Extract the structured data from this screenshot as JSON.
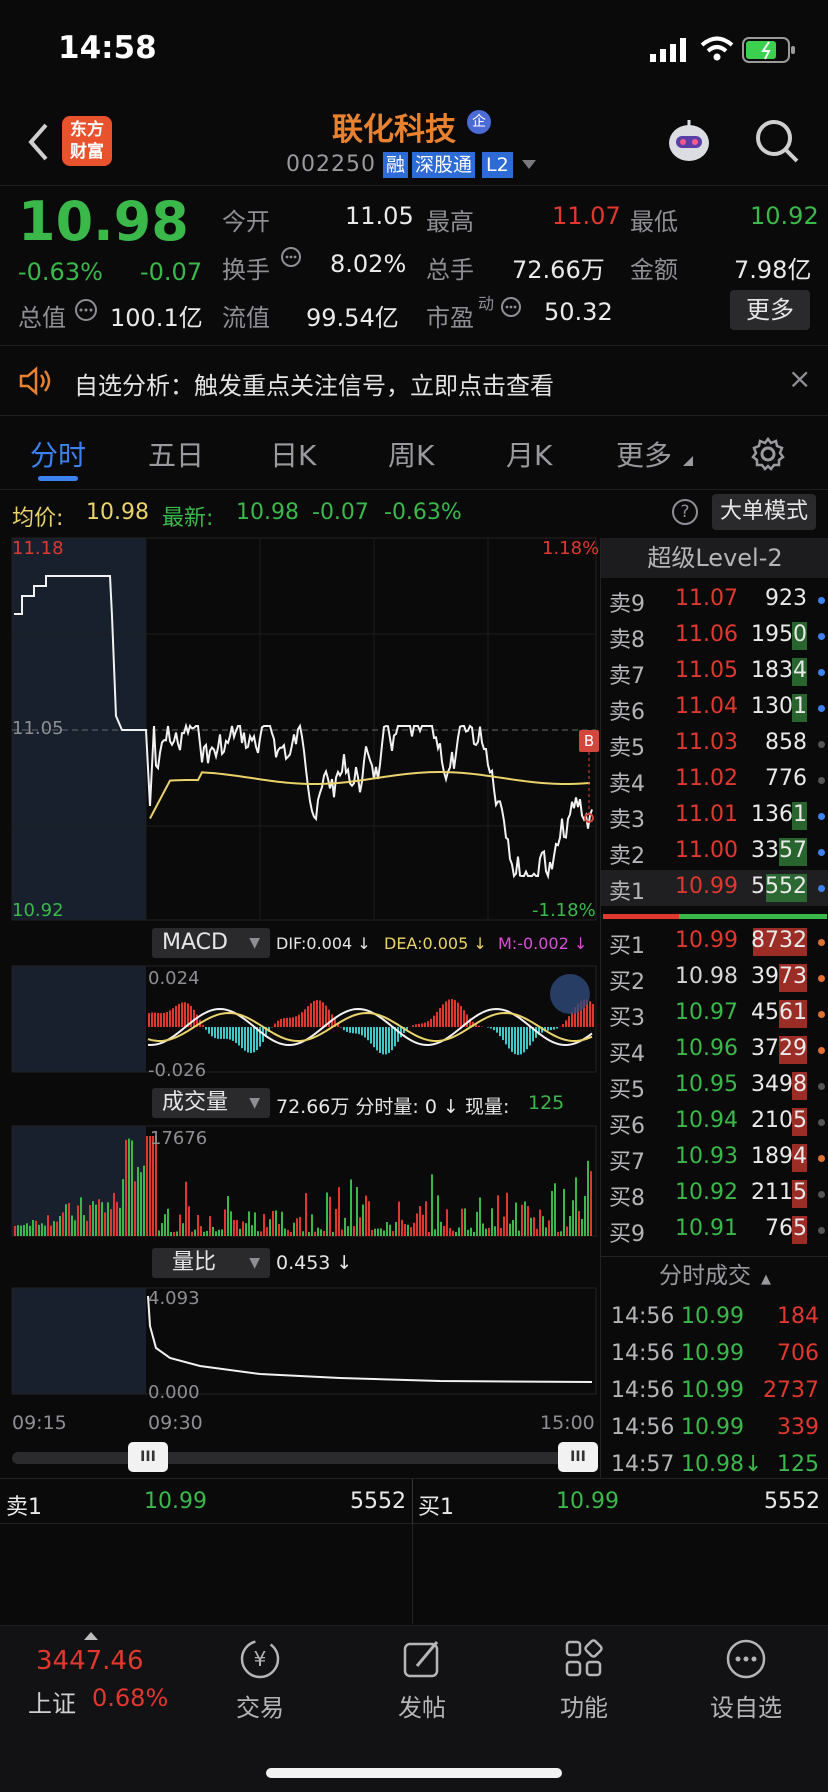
{
  "status": {
    "time": "14:58"
  },
  "header": {
    "logo_line1": "东方",
    "logo_line2": "财富",
    "stock_name": "联化科技",
    "corp_badge": "企",
    "stock_code": "002250",
    "tags": [
      "融",
      "深股通",
      "L2"
    ]
  },
  "quote": {
    "price": "10.98",
    "change_pct": "-0.63%",
    "change": "-0.07",
    "market_value_label": "总值",
    "market_value": "100.1亿",
    "float_value_label": "流值",
    "float_value": "99.54亿",
    "stats": [
      {
        "label": "今开",
        "value": "11.05"
      },
      {
        "label": "最高",
        "value": "11.07"
      },
      {
        "label": "最低",
        "value": "10.92"
      },
      {
        "label": "换手",
        "value": "8.02%"
      },
      {
        "label": "总手",
        "value": "72.66万"
      },
      {
        "label": "金额",
        "value": "7.98亿"
      },
      {
        "label": "市盈",
        "sup": "动",
        "value": "50.32"
      }
    ],
    "more_button": "更多"
  },
  "notice": {
    "text": "自选分析：触发重点关注信号，立即点击查看",
    "close": "×"
  },
  "tabs": [
    "分时",
    "五日",
    "日K",
    "周K",
    "月K",
    "更多"
  ],
  "avg_line": {
    "avg_label": "均价:",
    "avg_value": "10.98",
    "latest_label": "最新:",
    "latest_value": "10.98",
    "latest_change": "-0.07",
    "latest_pct": "-0.63%",
    "help": "?",
    "big_order_button": "大单模式"
  },
  "intraday": {
    "price_top": "11.18",
    "price_mid": "11.05",
    "price_bottom": "10.92",
    "pct_top": "1.18%",
    "pct_bottom": "-1.18%",
    "marker_b": "B",
    "macd_label": "MACD",
    "dif": "DIF:0.004 ↓",
    "dea": "DEA:0.005 ↓",
    "m": "M:-0.002 ↓",
    "macd_top": "0.024",
    "macd_bottom": "-0.026",
    "vol_label": "成交量",
    "vol_info": "72.66万 分时量: 0 ↓ 现量:",
    "vol_now": "125",
    "vol_max": "17676",
    "ratio_label": "量比",
    "ratio_value": "0.453 ↓",
    "ratio_top": "4.093",
    "ratio_bottom": "0.000",
    "time_start": "09:15",
    "time_open": "09:30",
    "time_end": "15:00",
    "handle": "III"
  },
  "orderbook": {
    "title": "超级Level-2",
    "asks": [
      {
        "label": "卖9",
        "price": "11.07",
        "vol": "923"
      },
      {
        "label": "卖8",
        "price": "11.06",
        "vol": "1950"
      },
      {
        "label": "卖7",
        "price": "11.05",
        "vol": "1834"
      },
      {
        "label": "卖6",
        "price": "11.04",
        "vol": "1301"
      },
      {
        "label": "卖5",
        "price": "11.03",
        "vol": "858"
      },
      {
        "label": "卖4",
        "price": "11.02",
        "vol": "776"
      },
      {
        "label": "卖3",
        "price": "11.01",
        "vol": "1361"
      },
      {
        "label": "卖2",
        "price": "11.00",
        "vol": "3357"
      },
      {
        "label": "卖1",
        "price": "10.99",
        "vol": "5552"
      }
    ],
    "bids": [
      {
        "label": "买1",
        "price": "10.99",
        "vol": "8732"
      },
      {
        "label": "买2",
        "price": "10.98",
        "vol": "3973"
      },
      {
        "label": "买3",
        "price": "10.97",
        "vol": "4561"
      },
      {
        "label": "买4",
        "price": "10.96",
        "vol": "3729"
      },
      {
        "label": "买5",
        "price": "10.95",
        "vol": "3498"
      },
      {
        "label": "买6",
        "price": "10.94",
        "vol": "2105"
      },
      {
        "label": "买7",
        "price": "10.93",
        "vol": "1894"
      },
      {
        "label": "买8",
        "price": "10.92",
        "vol": "2115"
      },
      {
        "label": "买9",
        "price": "10.91",
        "vol": "765"
      }
    ],
    "trades_title": "分时成交",
    "trades": [
      {
        "time": "14:56",
        "price": "10.99",
        "vol": "184"
      },
      {
        "time": "14:56",
        "price": "10.99",
        "vol": "706"
      },
      {
        "time": "14:56",
        "price": "10.99",
        "vol": "2737"
      },
      {
        "time": "14:56",
        "price": "10.99",
        "vol": "339"
      },
      {
        "time": "14:57",
        "price": "10.98↓",
        "vol": "125"
      }
    ]
  },
  "bidask_bar": {
    "sell_label": "卖1",
    "sell_price": "10.99",
    "sell_vol": "5552",
    "buy_label": "买1",
    "buy_price": "10.99",
    "buy_vol": "5552"
  },
  "bottom_nav": {
    "index_value": "3447.46",
    "index_name": "上证",
    "index_pct": "0.68%",
    "items": [
      "交易",
      "发帖",
      "功能",
      "设自选"
    ]
  }
}
